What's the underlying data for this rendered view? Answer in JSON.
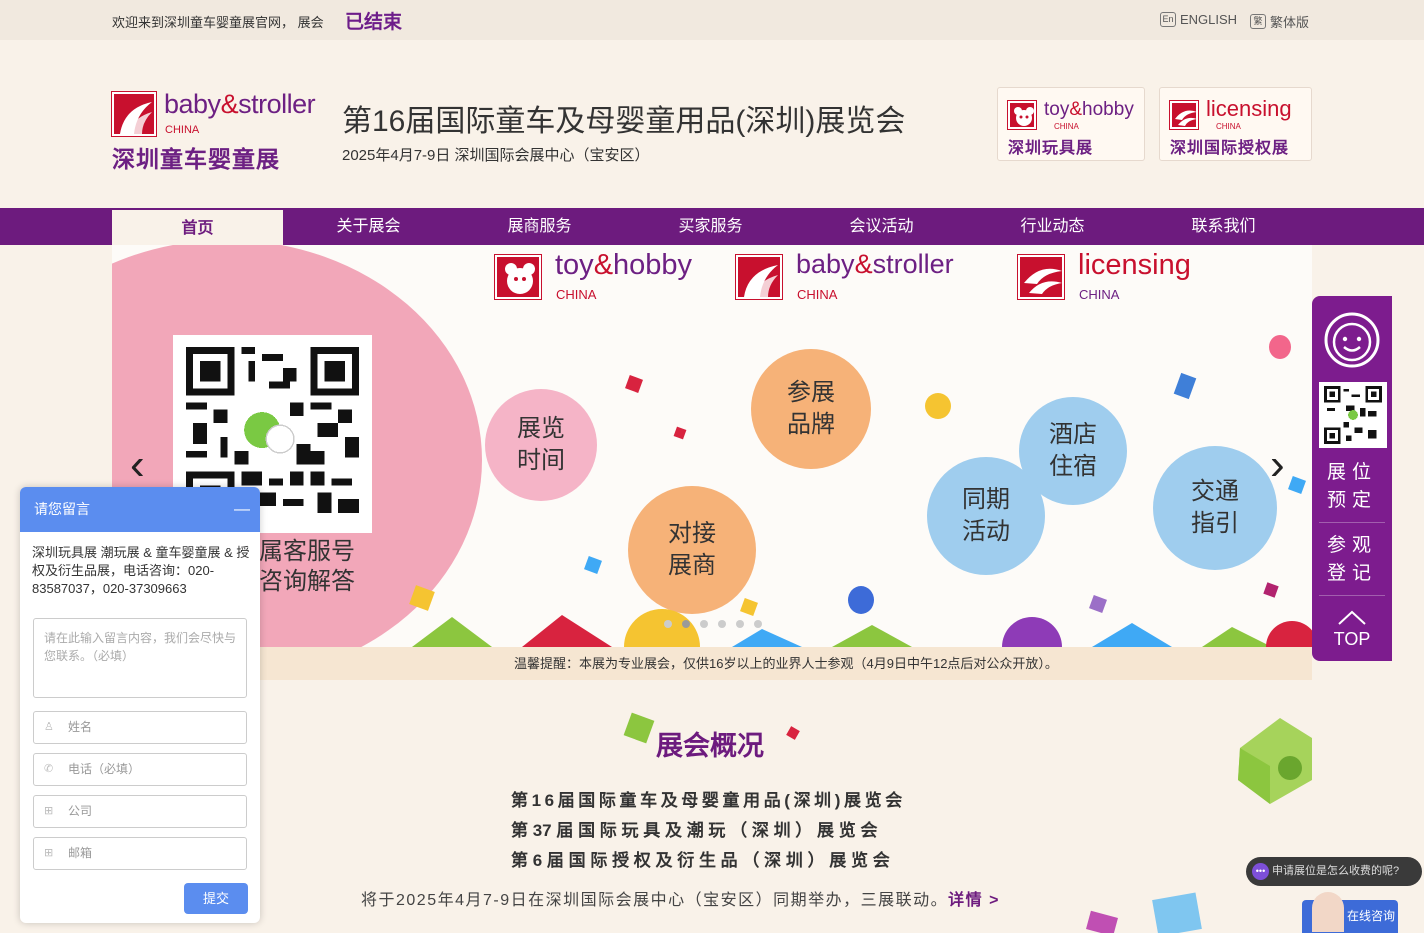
{
  "topbar": {
    "welcome": "欢迎来到深圳童车婴童展官网， 展会",
    "status": "已结束",
    "lang_en_icon": "En",
    "lang_en": "ENGLISH",
    "lang_tc_icon": "繁",
    "lang_tc": "繁体版"
  },
  "header": {
    "logo_en_a": "baby",
    "logo_en_amp": "&",
    "logo_en_b": "stroller",
    "logo_china": "CHINA",
    "logo_cn": "深圳童车婴童展",
    "title": "第16届国际童车及母婴童用品(深圳)展览会",
    "date": "2025年4月7-9日 深圳国际会展中心（宝安区）",
    "partner1_a": "toy",
    "partner1_amp": "&",
    "partner1_b": "hobby",
    "partner1_china": "CHINA",
    "partner1_cn": "深圳玩具展",
    "partner2_en": "licensing",
    "partner2_china": "CHINA",
    "partner2_cn": "深圳国际授权展"
  },
  "nav": [
    "首页",
    "关于展会",
    "展商服务",
    "买家服务",
    "会议活动",
    "行业动态",
    "联系我们"
  ],
  "banner": {
    "logo1_a": "toy",
    "logo1_amp": "&",
    "logo1_b": "hobby",
    "logo1_china": "CHINA",
    "logo2_a": "baby",
    "logo2_amp": "&",
    "logo2_b": "stroller",
    "logo2_china": "CHINA",
    "logo3": "licensing",
    "logo3_china": "CHINA",
    "service_line1": "属客服号",
    "service_line2": "咨询解答",
    "bubbles": {
      "time": [
        "展览",
        "时间"
      ],
      "brands": [
        "参展",
        "品牌"
      ],
      "exhibitors": [
        "对接",
        "展商"
      ],
      "hotel": [
        "酒店",
        "住宿"
      ],
      "events": [
        "同期",
        "活动"
      ],
      "traffic": [
        "交通",
        "指引"
      ]
    },
    "prev": "‹",
    "next": "›",
    "slide_count": 6,
    "active_slide": 1
  },
  "notice": "温馨提醒：本展为专业展会，仅供16岁以上的业界人士参观（4月9日中午12点后对公众开放）。",
  "overview": {
    "title": "展会概况",
    "line1": "第16届国际童车及母婴童用品(深圳)展览会",
    "line2": "第 37 届 国 际 玩 具 及 潮 玩 （ 深 圳 ） 展 览 会",
    "line3": "第 6 届 国 际 授 权 及 衍 生 品 （ 深 圳 ） 展 览 会",
    "desc": "将于2025年4月7-9日在深圳国际会展中心（宝安区）同期举办，三展联动。",
    "more": "详情 >"
  },
  "side": {
    "booth_1": "展位",
    "booth_2": "预定",
    "visit_1": "参观",
    "visit_2": "登记",
    "top": "TOP"
  },
  "form": {
    "header": "请您留言",
    "minimize": "—",
    "intro": "深圳玩具展 潮玩展 & 童车婴童展 & 授权及衍生品展，电话咨询：020-83587037，020-37309663",
    "message_placeholder": "请在此输入留言内容，我们会尽快与您联系。（必填）",
    "name_placeholder": "姓名",
    "phone_placeholder": "电话（必填）",
    "company_placeholder": "公司",
    "email_placeholder": "邮箱",
    "submit": "提交"
  },
  "chat": {
    "bubble": "申请展位是怎么收费的呢?",
    "online": "在线咨询"
  },
  "colors": {
    "brand_purple": "#6d1b7e",
    "brand_red": "#c8102e",
    "form_blue": "#5b8def"
  }
}
